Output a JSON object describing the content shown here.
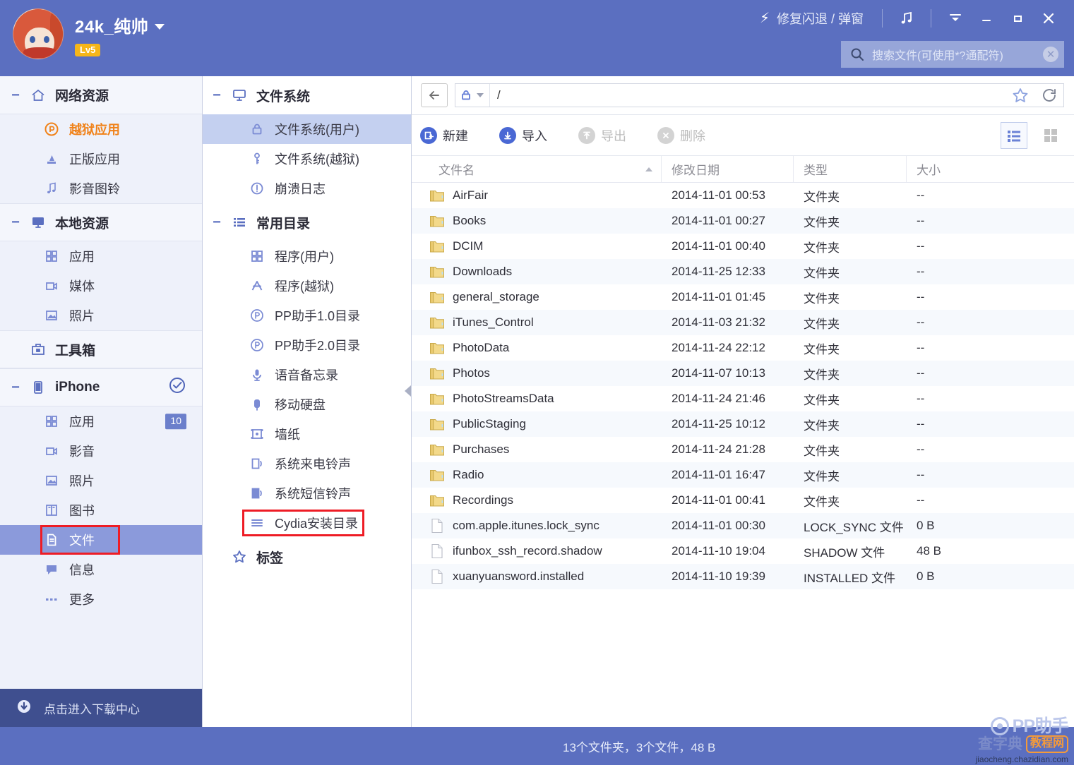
{
  "titlebar": {
    "username": "24k_纯帅",
    "level_badge": "Lv5",
    "avatar_name": "user-avatar",
    "fix_crash_label": "修复闪退 / 弹窗",
    "music_icon": "music-note-icon",
    "menu_icon": "menu-chevron-icon",
    "minimize_icon": "minimize-icon",
    "maximize_icon": "maximize-icon",
    "close_icon": "close-icon"
  },
  "search": {
    "placeholder": "搜索文件(可使用*?通配符)",
    "value": "",
    "icon": "search-icon",
    "clear_icon": "clear-circle-icon"
  },
  "sidebar": {
    "groups": [
      {
        "label": "网络资源",
        "icon": "home-icon",
        "collapse": "−",
        "items": [
          {
            "label": "越狱应用",
            "icon": "pp-logo-icon",
            "accent": true
          },
          {
            "label": "正版应用",
            "icon": "app-store-icon"
          },
          {
            "label": "影音图铃",
            "icon": "music-note-icon"
          }
        ]
      },
      {
        "label": "本地资源",
        "icon": "monitor-icon",
        "collapse": "−",
        "items": [
          {
            "label": "应用",
            "icon": "grid-apps-icon"
          },
          {
            "label": "媒体",
            "icon": "video-camera-icon"
          },
          {
            "label": "照片",
            "icon": "photo-icon"
          }
        ]
      },
      {
        "label": "工具箱",
        "icon": "toolbox-icon",
        "collapse": "",
        "items": []
      },
      {
        "label": "iPhone",
        "icon": "iphone-device-icon",
        "collapse": "−",
        "status_icon": "connected-check-icon",
        "items": [
          {
            "label": "应用",
            "icon": "grid-apps-icon",
            "badge": "10"
          },
          {
            "label": "影音",
            "icon": "video-camera-icon"
          },
          {
            "label": "照片",
            "icon": "photo-icon"
          },
          {
            "label": "图书",
            "icon": "book-icon"
          },
          {
            "label": "文件",
            "icon": "document-icon",
            "selected": true,
            "highlighted": true
          },
          {
            "label": "信息",
            "icon": "message-icon"
          },
          {
            "label": "更多",
            "icon": "more-dots-icon"
          }
        ]
      }
    ],
    "download_center": {
      "label": "点击进入下载中心",
      "icon": "download-arrow-icon"
    }
  },
  "tree": {
    "groups": [
      {
        "label": "文件系统",
        "icon": "monitor-icon",
        "collapse": "−",
        "items": [
          {
            "label": "文件系统(用户)",
            "icon": "lock-icon",
            "selected": true
          },
          {
            "label": "文件系统(越狱)",
            "icon": "key-icon"
          },
          {
            "label": "崩溃日志",
            "icon": "alert-circle-icon"
          }
        ]
      },
      {
        "label": "常用目录",
        "icon": "list-icon",
        "collapse": "−",
        "items": [
          {
            "label": "程序(用户)",
            "icon": "grid-apps-icon"
          },
          {
            "label": "程序(越狱)",
            "icon": "cydia-icon"
          },
          {
            "label": "PP助手1.0目录",
            "icon": "pp-logo-icon"
          },
          {
            "label": "PP助手2.0目录",
            "icon": "pp-logo-icon"
          },
          {
            "label": "语音备忘录",
            "icon": "microphone-icon"
          },
          {
            "label": "移动硬盘",
            "icon": "usb-drive-icon"
          },
          {
            "label": "墙纸",
            "icon": "wallpaper-icon"
          },
          {
            "label": "系统来电铃声",
            "icon": "ringtone-icon"
          },
          {
            "label": "系统短信铃声",
            "icon": "sms-tone-icon"
          },
          {
            "label": "Cydia安装目录",
            "icon": "list-lines-icon",
            "highlighted": true
          }
        ]
      },
      {
        "label": "标签",
        "icon": "star-icon",
        "collapse": "",
        "items": []
      }
    ],
    "collapse_handle_icon": "collapse-left-arrow-icon"
  },
  "addressbar": {
    "back_icon": "back-arrow-icon",
    "lock_icon": "lock-icon",
    "dropdown_icon": "chevron-down-icon",
    "path": "/",
    "star_icon": "favorite-star-icon",
    "refresh_icon": "refresh-icon"
  },
  "toolbar": {
    "buttons": [
      {
        "label": "新建",
        "icon": "new-folder-icon",
        "disabled": false
      },
      {
        "label": "导入",
        "icon": "import-icon",
        "disabled": false
      },
      {
        "label": "导出",
        "icon": "export-icon",
        "disabled": true
      },
      {
        "label": "删除",
        "icon": "delete-icon",
        "disabled": true
      }
    ],
    "view_list_icon": "list-view-icon",
    "view_grid_icon": "grid-view-icon",
    "active_view": "list"
  },
  "filelist": {
    "columns": [
      "文件名",
      "修改日期",
      "类型",
      "大小"
    ],
    "sort_column": "文件名",
    "sort_direction": "asc",
    "rows": [
      {
        "name": "AirFair",
        "date": "2014-11-01 00:53",
        "type": "文件夹",
        "size": "--",
        "kind": "folder"
      },
      {
        "name": "Books",
        "date": "2014-11-01 00:27",
        "type": "文件夹",
        "size": "--",
        "kind": "folder"
      },
      {
        "name": "DCIM",
        "date": "2014-11-01 00:40",
        "type": "文件夹",
        "size": "--",
        "kind": "folder"
      },
      {
        "name": "Downloads",
        "date": "2014-11-25 12:33",
        "type": "文件夹",
        "size": "--",
        "kind": "folder"
      },
      {
        "name": "general_storage",
        "date": "2014-11-01 01:45",
        "type": "文件夹",
        "size": "--",
        "kind": "folder"
      },
      {
        "name": "iTunes_Control",
        "date": "2014-11-03 21:32",
        "type": "文件夹",
        "size": "--",
        "kind": "folder"
      },
      {
        "name": "PhotoData",
        "date": "2014-11-24 22:12",
        "type": "文件夹",
        "size": "--",
        "kind": "folder"
      },
      {
        "name": "Photos",
        "date": "2014-11-07 10:13",
        "type": "文件夹",
        "size": "--",
        "kind": "folder"
      },
      {
        "name": "PhotoStreamsData",
        "date": "2014-11-24 21:46",
        "type": "文件夹",
        "size": "--",
        "kind": "folder"
      },
      {
        "name": "PublicStaging",
        "date": "2014-11-25 10:12",
        "type": "文件夹",
        "size": "--",
        "kind": "folder"
      },
      {
        "name": "Purchases",
        "date": "2014-11-24 21:28",
        "type": "文件夹",
        "size": "--",
        "kind": "folder"
      },
      {
        "name": "Radio",
        "date": "2014-11-01 16:47",
        "type": "文件夹",
        "size": "--",
        "kind": "folder"
      },
      {
        "name": "Recordings",
        "date": "2014-11-01 00:41",
        "type": "文件夹",
        "size": "--",
        "kind": "folder"
      },
      {
        "name": "com.apple.itunes.lock_sync",
        "date": "2014-11-01 00:30",
        "type": "LOCK_SYNC 文件",
        "size": "0 B",
        "kind": "file"
      },
      {
        "name": "ifunbox_ssh_record.shadow",
        "date": "2014-11-10 19:04",
        "type": "SHADOW 文件",
        "size": "48 B",
        "kind": "file"
      },
      {
        "name": "xuanyuansword.installed",
        "date": "2014-11-10 19:39",
        "type": "INSTALLED 文件",
        "size": "0 B",
        "kind": "file"
      }
    ]
  },
  "statusbar": {
    "summary": "13个文件夹，3个文件，48 B"
  },
  "watermark": {
    "brand": "PP助手",
    "site_cn": "查字典",
    "site_tag": "教程网",
    "url": "jiaocheng.chazidian.com"
  },
  "colors": {
    "brand_blue": "#5b6fc0",
    "accent_orange": "#f08219",
    "selection_blue": "#8b9adb",
    "tree_selection": "#c4d0f0",
    "highlight_red": "#ee1c25",
    "badge_yellow": "#f6b619",
    "download_bar": "#3f4f8f"
  }
}
